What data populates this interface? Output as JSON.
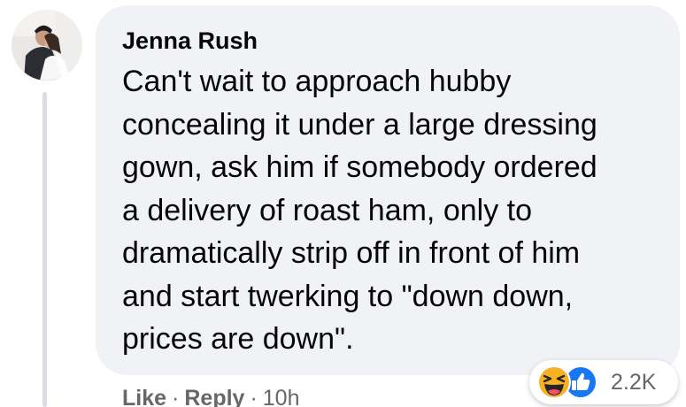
{
  "comment": {
    "author": "Jenna Rush",
    "text": "Can't wait to approach hubby\nconcealing it under a large dressing\ngown, ask him if somebody ordered\na delivery of roast ham, only to\ndramatically strip off in front of him\nand start twerking to \"down down,\nprices are down\".",
    "avatar_icon": "profile-photo-avatar"
  },
  "actions": {
    "like_label": "Like",
    "separator": "·",
    "reply_label": "Reply",
    "timestamp": "10h"
  },
  "reactions": {
    "icons": [
      "haha-reaction-icon",
      "like-reaction-icon"
    ],
    "count": "2.2K"
  },
  "colors": {
    "bubble": "#f0f2f5",
    "text": "#050505",
    "meta": "#65676b",
    "like_blue": "#1877f2",
    "haha_yellow": "#f7b125"
  }
}
